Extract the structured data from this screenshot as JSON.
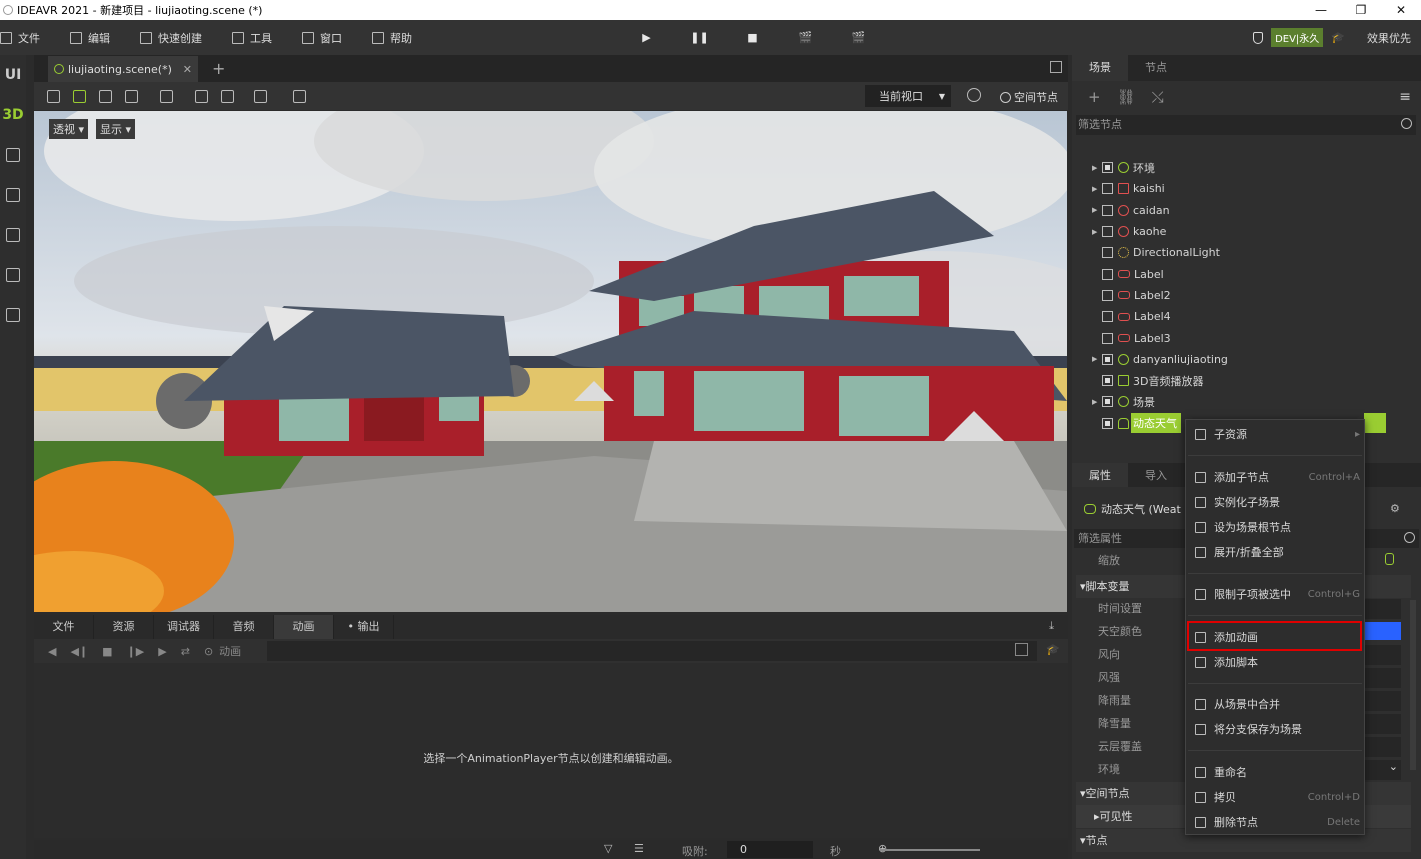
{
  "window": {
    "title": "IDEAVR 2021 - 新建项目 - liujiaoting.scene (*)",
    "minimize": "—",
    "restore": "❐",
    "close": "✕"
  },
  "menubar": {
    "items": [
      "文件",
      "编辑",
      "快速创建",
      "工具",
      "窗口",
      "帮助"
    ],
    "play": "▶",
    "pause": "❚❚",
    "stop": "■",
    "scene_play": "🎬",
    "scene_custom": "🎬",
    "dev_badge": "DEV|永久",
    "quality": "效果优先"
  },
  "leftbar": {
    "ui_label": "UI",
    "3d_label": "3D"
  },
  "scene_tab": {
    "label": "liujiaoting.scene(*)",
    "close": "✕",
    "add": "+"
  },
  "viewport_toolbar": {
    "viewport_select": "当前视口",
    "spatial_node": "空间节点"
  },
  "viewport": {
    "perspective_btn": "透视 ▾",
    "display_btn": "显示 ▾"
  },
  "bottom_panel": {
    "tabs": [
      "文件",
      "资源",
      "调试器",
      "音频",
      "动画",
      "• 输出"
    ],
    "active_tab": "动画",
    "anim_label": "动画",
    "message": "选择一个AnimationPlayer节点以创建和编辑动画。",
    "snap_label": "吸附:",
    "snap_value": "0",
    "snap_unit": "秒"
  },
  "scene_dock": {
    "tabs": [
      "场景",
      "节点"
    ],
    "filter_placeholder": "筛选节点",
    "tree": [
      {
        "name": "环境",
        "expand": true,
        "checked": true,
        "icon": "circle"
      },
      {
        "name": "kaishi",
        "expand": true,
        "checked": false,
        "icon": "image"
      },
      {
        "name": "caidan",
        "expand": true,
        "checked": false,
        "icon": "red-circle"
      },
      {
        "name": "kaohe",
        "expand": true,
        "checked": false,
        "icon": "red-circle"
      },
      {
        "name": "DirectionalLight",
        "expand": false,
        "checked": false,
        "icon": "sun"
      },
      {
        "name": "Label",
        "expand": false,
        "checked": false,
        "icon": "tag"
      },
      {
        "name": "Label2",
        "expand": false,
        "checked": false,
        "icon": "tag"
      },
      {
        "name": "Label4",
        "expand": false,
        "checked": false,
        "icon": "tag"
      },
      {
        "name": "Label3",
        "expand": false,
        "checked": false,
        "icon": "tag"
      },
      {
        "name": "danyanliujiaoting",
        "expand": true,
        "checked": true,
        "icon": "circle"
      },
      {
        "name": "3D音频播放器",
        "expand": false,
        "checked": true,
        "icon": "audio"
      },
      {
        "name": "场景",
        "expand": true,
        "checked": true,
        "icon": "circle"
      },
      {
        "name": "动态天气",
        "expand": false,
        "checked": true,
        "icon": "cloud",
        "selected": true
      }
    ]
  },
  "props_dock": {
    "tabs": [
      "属性",
      "导入"
    ],
    "node_title": "动态天气 (Weat",
    "filter_placeholder": "筛选属性",
    "rows": [
      "缩放",
      "▾脚本变量",
      "时间设置",
      "天空颜色",
      "风向",
      "风强",
      "降雨量",
      "降雪量",
      "云层覆盖",
      "环境",
      "▾空间节点",
      "▸可见性",
      "▾节点"
    ]
  },
  "context_menu": {
    "items": [
      {
        "label": "子资源",
        "shortcut": "▸"
      },
      {
        "label": "添加子节点",
        "shortcut": "Control+A"
      },
      {
        "label": "实例化子场景",
        "shortcut": ""
      },
      {
        "label": "设为场景根节点",
        "shortcut": ""
      },
      {
        "label": "展开/折叠全部",
        "shortcut": ""
      },
      {
        "label": "限制子项被选中",
        "shortcut": "Control+G"
      },
      {
        "label": "添加动画",
        "shortcut": ""
      },
      {
        "label": "添加脚本",
        "shortcut": ""
      },
      {
        "label": "从场景中合并",
        "shortcut": ""
      },
      {
        "label": "将分支保存为场景",
        "shortcut": ""
      },
      {
        "label": "重命名",
        "shortcut": ""
      },
      {
        "label": "拷贝",
        "shortcut": "Control+D"
      },
      {
        "label": "删除节点",
        "shortcut": "Delete"
      }
    ]
  },
  "colors": {
    "accent": "#9acd32",
    "highlight_border": "#e00000",
    "sky_color_swatch": "#2962ff"
  }
}
